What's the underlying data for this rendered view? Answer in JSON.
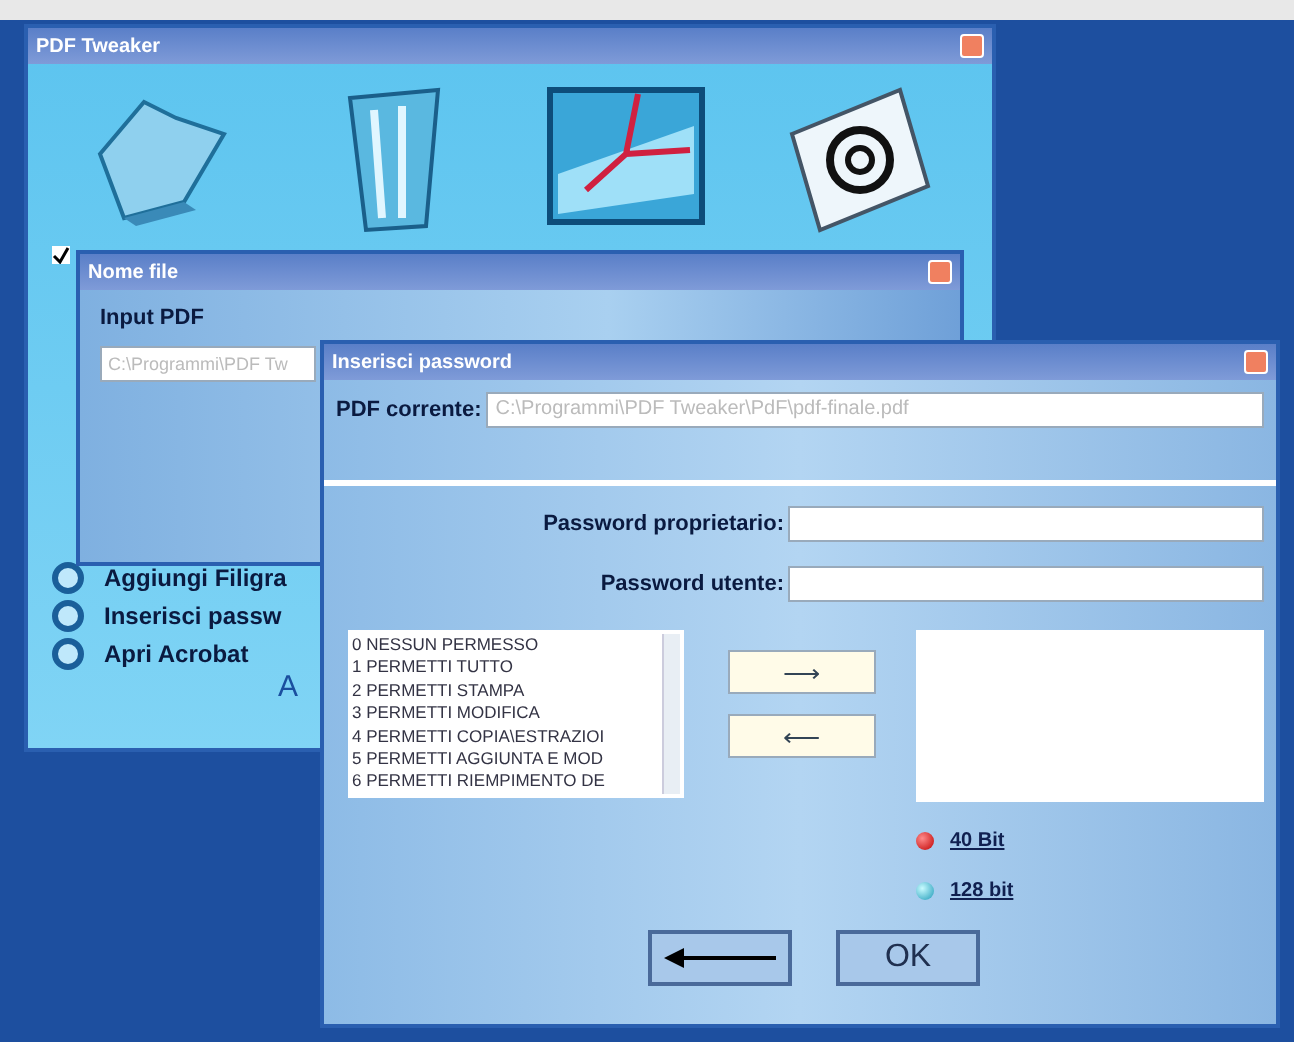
{
  "main_window": {
    "title": "PDF Tweaker",
    "options": [
      {
        "label": "Aggiungi Filigra",
        "selected": false
      },
      {
        "label": "Inserisci passw",
        "selected": false
      },
      {
        "label": "Apri Acrobat",
        "selected": false
      }
    ],
    "footer_text": "A"
  },
  "file_window": {
    "title": "Nome file",
    "checked": true,
    "input_label": "Input PDF",
    "input_value": "C:\\Programmi\\PDF Tw"
  },
  "password_dialog": {
    "title": "Inserisci password",
    "current_label": "PDF corrente:",
    "current_value": "C:\\Programmi\\PDF Tweaker\\PdF\\pdf-finale.pdf",
    "owner_label": "Password proprietario:",
    "user_label": "Password utente:",
    "permissions": [
      "0 NESSUN PERMESSO",
      "1 PERMETTI TUTTO",
      "2 PERMETTI STAMPA",
      "3 PERMETTI MODIFICA",
      "4 PERMETTI COPIA\\ESTRAZIOI",
      "5 PERMETTI AGGIUNTA E MOD",
      "6 PERMETTI RIEMPIMENTO DE"
    ],
    "add_button": "⟶",
    "remove_button": "⟵",
    "encryption": [
      {
        "label": "40 Bit",
        "selected": true
      },
      {
        "label": "128 bit",
        "selected": false
      }
    ],
    "ok_button": "OK"
  }
}
